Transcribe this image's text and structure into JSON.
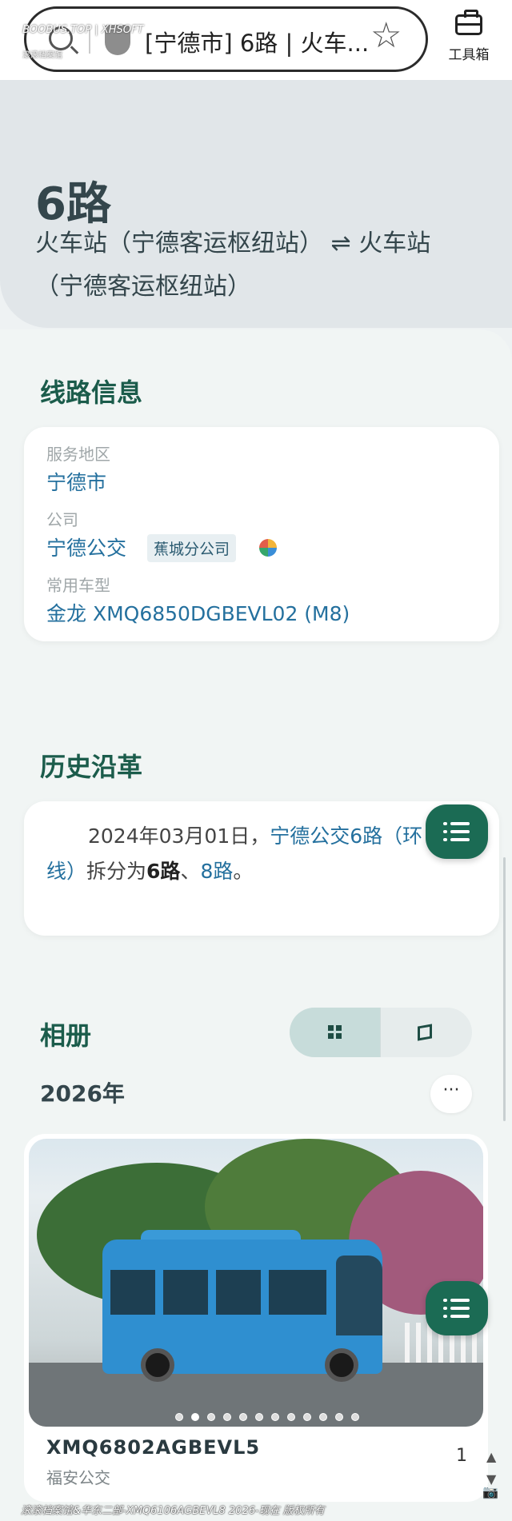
{
  "watermark": {
    "top": "BOOBUS.TOP | XHSOFT",
    "top_sub": "滚滚档案馆",
    "bottom": "滚滚档案馆&华东二部-XMQ6106AGBEVL8 2026-现在 版权所有"
  },
  "browser": {
    "url_title": "[宁德市] 6路 | 火车...",
    "toolbox_label": "工具箱"
  },
  "route": {
    "number": "6路",
    "destination": "火车站（宁德客运枢纽站） ⇌ 火车站（宁德客运枢纽站）"
  },
  "line_info": {
    "title": "线路信息",
    "service_area_label": "服务地区",
    "service_area": "宁德市",
    "company_label": "公司",
    "company": "宁德公交",
    "branch": "蕉城分公司",
    "vehicle_label": "常用车型",
    "vehicle": "金龙 XMQ6850DGBEVL02 (M8)"
  },
  "history": {
    "title": "历史沿革",
    "date": "2024年03月01日，",
    "link_route": "宁德公交6路（环",
    "link_cont": "线）",
    "text_mid": "拆分为",
    "route_a": "6路",
    "sep": "、",
    "route_b": "8路",
    "end": "。"
  },
  "album": {
    "title": "相册",
    "year": "2026年",
    "more": "···",
    "photo": {
      "model": "XMQ6802AGBEVL5",
      "company": "福安公交",
      "count": "1",
      "dots": 12,
      "active_dot": 1
    }
  },
  "colors": {
    "accent": "#1b5c4b",
    "link": "#24709e",
    "fab": "#1b6b54"
  },
  "icons": [
    "search-icon",
    "shield-icon",
    "star-icon",
    "toolbox-icon",
    "list-icon",
    "grid-icon",
    "map-icon",
    "more-icon",
    "chevron-up-icon",
    "chevron-down-icon",
    "camera-icon"
  ]
}
